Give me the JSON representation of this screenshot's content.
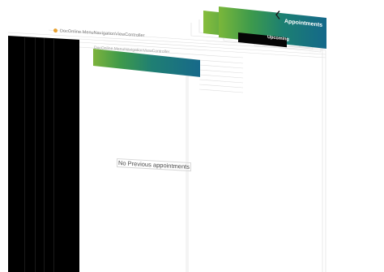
{
  "navigation": {
    "title": "Appointments",
    "back_icon": "chevron-left-icon"
  },
  "view_controller": {
    "name": "DocOnline.MenuNavigationViewController",
    "secondary_name": "DocOnline.MenuNavigationViewController",
    "dot_color": "#e8a233"
  },
  "segments": {
    "upcoming_label": "Upcoming"
  },
  "main": {
    "empty_message": "No Previous appointments"
  },
  "colors": {
    "gradient_start": "#7ab73a",
    "gradient_end": "#14688a",
    "side_panel": "#000000"
  }
}
